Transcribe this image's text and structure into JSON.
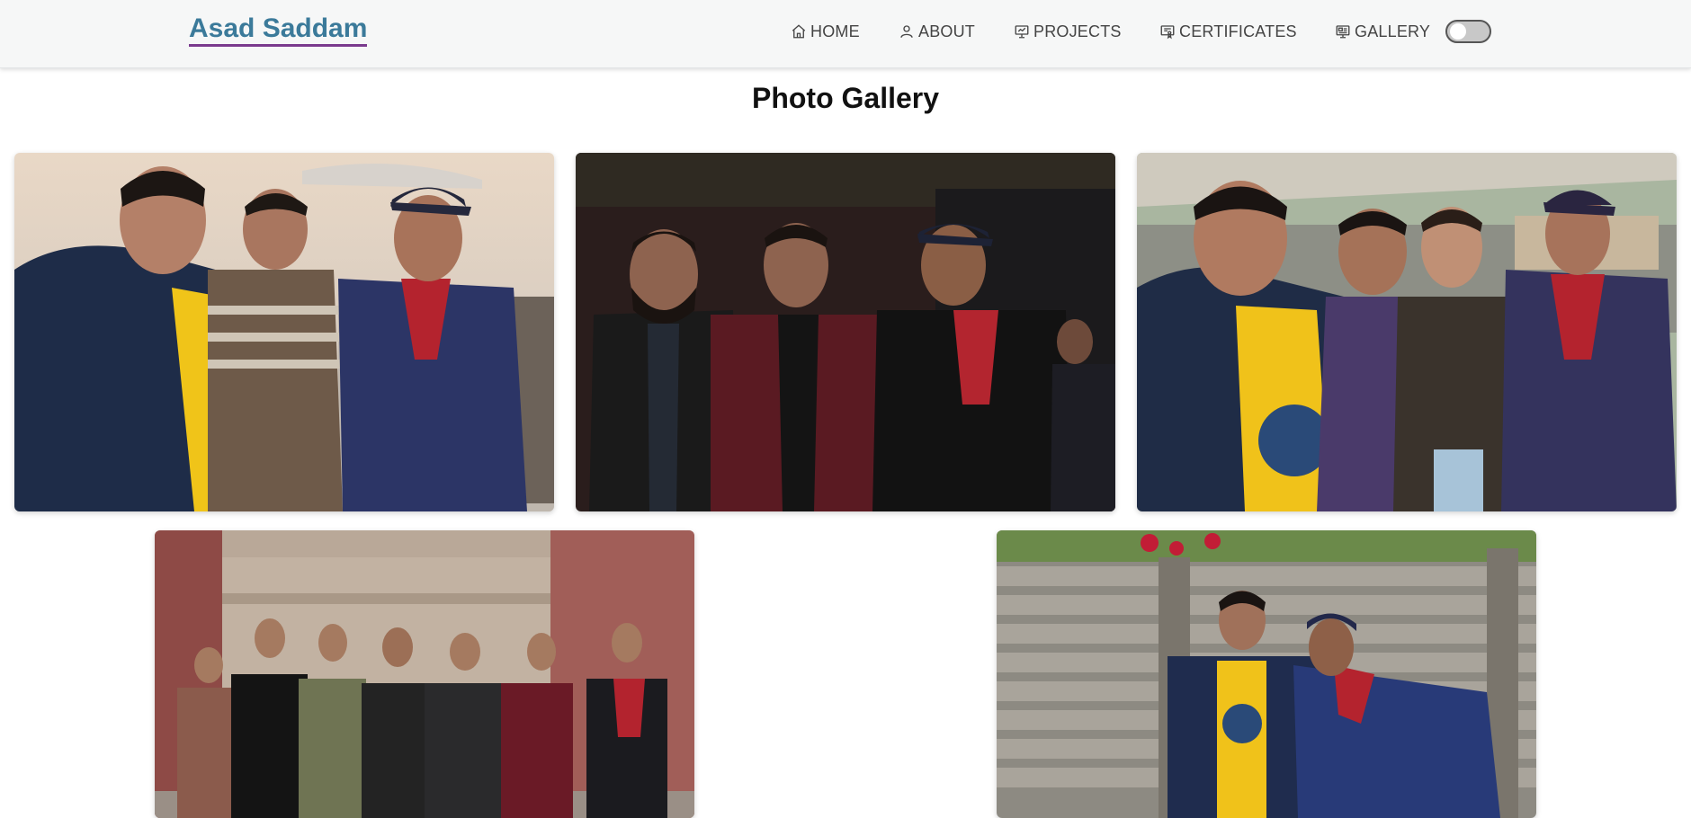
{
  "brand": "Asad Saddam",
  "nav": {
    "home": "HOME",
    "about": "ABOUT",
    "projects": "PROJECTS",
    "certificates": "CERTIFICATES",
    "gallery": "GALLERY"
  },
  "icons": {
    "home": "home-icon",
    "about": "user-icon",
    "projects": "presentation-icon",
    "certificates": "certificate-icon",
    "gallery": "gallery-icon"
  },
  "theme_toggle": {
    "state": "off"
  },
  "gallery": {
    "title": "Photo Gallery",
    "photos": [
      {
        "name": "group-selfie-outdoor-cafe"
      },
      {
        "name": "three-friends-night"
      },
      {
        "name": "group-selfie-terrace"
      },
      {
        "name": "group-photo-courtyard"
      },
      {
        "name": "two-friends-wooden-fence"
      }
    ]
  },
  "colors": {
    "brand": "#3b7a9a",
    "brand_underline": "#7a3a8e",
    "nav_bg": "#f6f7f7"
  }
}
